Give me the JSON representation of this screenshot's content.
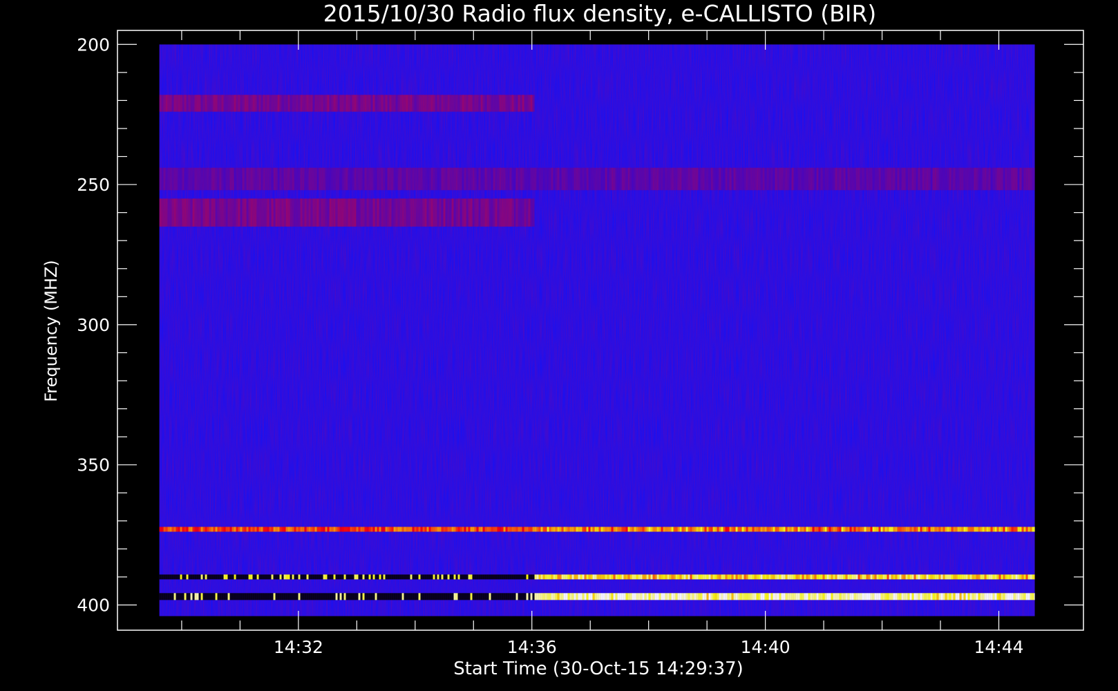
{
  "chart_data": {
    "type": "heatmap",
    "title": "2015/10/30  Radio flux density, e-CALLISTO (BIR)",
    "ylabel": "Frequency (MHZ)",
    "xlabel": "Start Time (30-Oct-15 14:29:37)",
    "y_ticks": [
      "200",
      "250",
      "300",
      "350",
      "400"
    ],
    "y_tick_values": [
      200,
      250,
      300,
      350,
      400
    ],
    "x_ticks": [
      "14:32",
      "14:36",
      "14:40",
      "14:44"
    ],
    "x_tick_values_min": [
      2.383,
      6.383,
      10.383,
      14.383
    ],
    "ylim": [
      195,
      409
    ],
    "x_range_min": [
      -0.717,
      15.833
    ],
    "data_x_range_min": [
      0,
      15
    ],
    "data_y_range": [
      200,
      404
    ],
    "y_inverted": true,
    "colormap": [
      "#000000",
      "#0000ff",
      "#ff0000",
      "#ffff00",
      "#ffffff"
    ],
    "background_color": "#1a10f0",
    "grid": false,
    "features": [
      {
        "kind": "band",
        "freq_range": [
          218,
          224
        ],
        "time_min": [
          0,
          6.4
        ],
        "intensity": 0.3
      },
      {
        "kind": "band",
        "freq_range": [
          244,
          252
        ],
        "time_min": [
          0,
          15
        ],
        "intensity": 0.22
      },
      {
        "kind": "band",
        "freq_range": [
          255,
          265
        ],
        "time_min": [
          0,
          6.4
        ],
        "intensity": 0.3
      },
      {
        "kind": "line",
        "freq": 373,
        "time_min": [
          0,
          15
        ],
        "intensity": 0.55
      },
      {
        "kind": "line",
        "freq": 390,
        "time_min": [
          0,
          15
        ],
        "intensity": 0.75
      },
      {
        "kind": "line",
        "freq": 397,
        "time_min": [
          0,
          15
        ],
        "intensity": 1.0
      }
    ]
  }
}
